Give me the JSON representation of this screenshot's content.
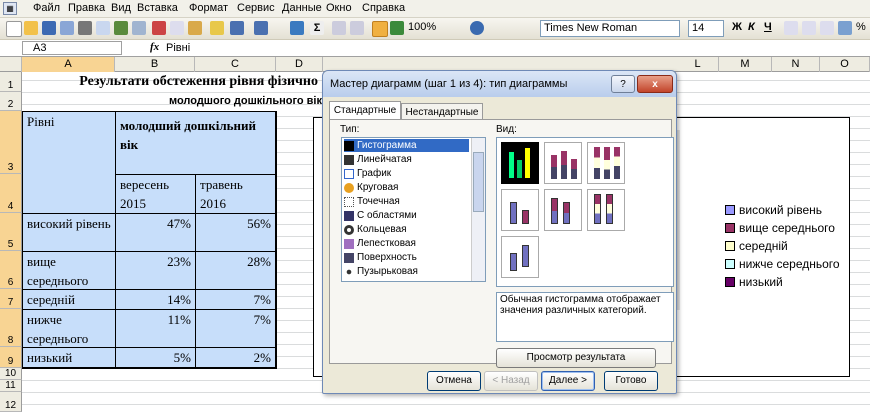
{
  "menu": {
    "items": [
      "Файл",
      "Правка",
      "Вид",
      "Вставка",
      "Формат",
      "Сервис",
      "Данные",
      "Окно",
      "Справка"
    ]
  },
  "toolbar": {
    "zoom": "100%",
    "font": "Times New Roman",
    "size": "14",
    "bold": "Ж",
    "italic": "К",
    "underline": "Ч",
    "percent": "%"
  },
  "formula": {
    "namebox": "A3",
    "fx": "fx",
    "value": "Рівні"
  },
  "columns": [
    "A",
    "B",
    "C",
    "D",
    "L",
    "M",
    "N",
    "O"
  ],
  "rows": [
    "1",
    "2",
    "3",
    "4",
    "5",
    "6",
    "7",
    "8",
    "9",
    "10",
    "11",
    "12"
  ],
  "sheet": {
    "title": "Результати обстеження рівня фізично",
    "subtitle": "молодшого дошкільного вік",
    "header_levels": "Рівні",
    "header_age": "молодший дошкільний вік",
    "header_col1": "вересень 2015",
    "header_col2": "травень 2016",
    "rows": [
      {
        "label": "високий рівень",
        "v1": "47%",
        "v2": "56%"
      },
      {
        "label": "вище середнього",
        "v1": "23%",
        "v2": "28%"
      },
      {
        "label": "середній",
        "v1": "14%",
        "v2": "7%"
      },
      {
        "label": "нижче середнього",
        "v1": "11%",
        "v2": "7%"
      },
      {
        "label": "низький",
        "v1": "5%",
        "v2": "2%"
      }
    ]
  },
  "legend": {
    "items": [
      {
        "label": "високий рівень",
        "color": "#9999ff"
      },
      {
        "label": "вище середнього",
        "color": "#993366"
      },
      {
        "label": "середній",
        "color": "#ffffcc"
      },
      {
        "label": "нижче середнього",
        "color": "#ccffff"
      },
      {
        "label": "низький",
        "color": "#660066"
      }
    ]
  },
  "dialog": {
    "title": "Мастер диаграмм (шаг 1 из 4): тип диаграммы",
    "help": "?",
    "close": "x",
    "tab_standard": "Стандартные",
    "tab_custom": "Нестандартные",
    "type_label": "Тип:",
    "view_label": "Вид:",
    "types": [
      "Гистограмма",
      "Линейчатая",
      "График",
      "Круговая",
      "Точечная",
      "С областями",
      "Кольцевая",
      "Лепестковая",
      "Поверхность",
      "Пузырьковая"
    ],
    "description": "Обычная гистограмма отображает значения различных категорий.",
    "preview_button": "Просмотр результата",
    "cancel": "Отмена",
    "back": "< Назад",
    "next": "Далее >",
    "finish": "Готово"
  }
}
